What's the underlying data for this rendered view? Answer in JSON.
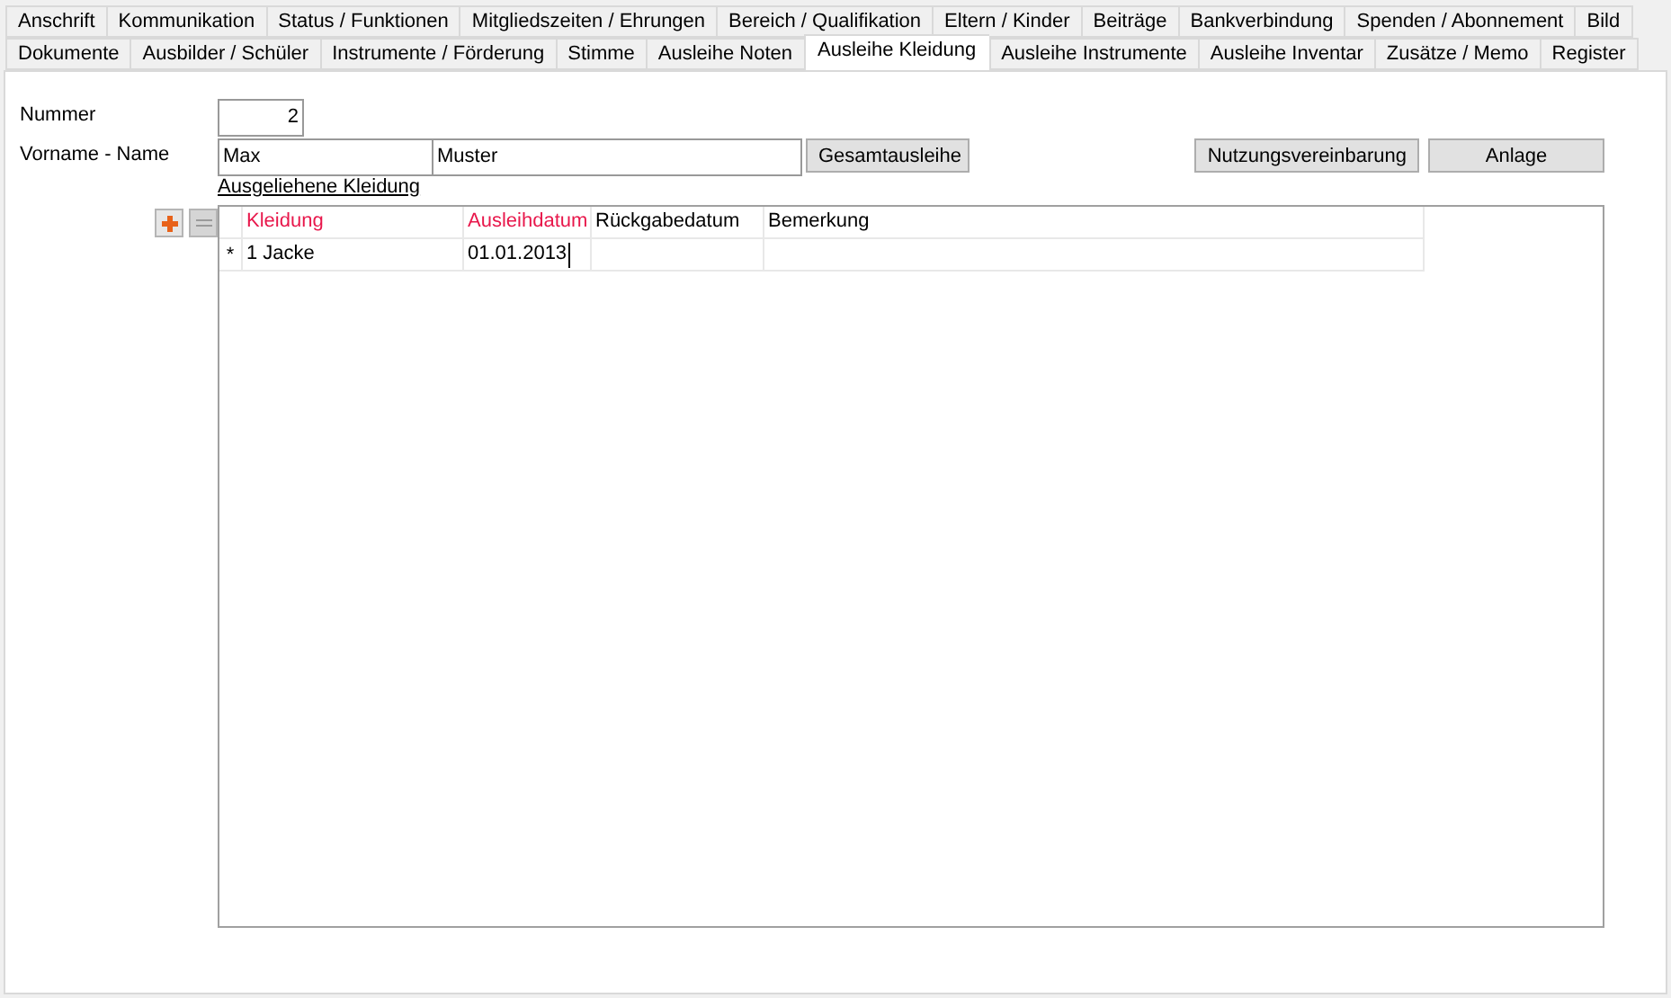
{
  "tab_rows": [
    [
      {
        "label": "Anschrift",
        "selected": false
      },
      {
        "label": "Kommunikation",
        "selected": false
      },
      {
        "label": "Status / Funktionen",
        "selected": false
      },
      {
        "label": "Mitgliedszeiten / Ehrungen",
        "selected": false
      },
      {
        "label": "Bereich / Qualifikation",
        "selected": false
      },
      {
        "label": "Eltern / Kinder",
        "selected": false
      },
      {
        "label": "Beiträge",
        "selected": false
      },
      {
        "label": "Bankverbindung",
        "selected": false
      },
      {
        "label": "Spenden / Abonnement",
        "selected": false
      },
      {
        "label": "Bild",
        "selected": false
      }
    ],
    [
      {
        "label": "Dokumente",
        "selected": false
      },
      {
        "label": "Ausbilder / Schüler",
        "selected": false
      },
      {
        "label": "Instrumente / Förderung",
        "selected": false
      },
      {
        "label": "Stimme",
        "selected": false
      },
      {
        "label": "Ausleihe Noten",
        "selected": false
      },
      {
        "label": "Ausleihe Kleidung",
        "selected": true
      },
      {
        "label": "Ausleihe Instrumente",
        "selected": false
      },
      {
        "label": "Ausleihe Inventar",
        "selected": false
      },
      {
        "label": "Zusätze / Memo",
        "selected": false
      },
      {
        "label": "Register",
        "selected": false
      }
    ]
  ],
  "form": {
    "number_label": "Nummer",
    "number": "2",
    "name_label": "Vorname - Name",
    "first_name": "Max",
    "last_name": "Muster",
    "total_button": "Gesamtausleihe",
    "agreement_button": "Nutzungsvereinbarung",
    "attachment_button": "Anlage"
  },
  "table": {
    "title": "Ausgeliehene Kleidung",
    "columns": [
      {
        "label": "Kleidung",
        "required": true
      },
      {
        "label": "Ausleihdatum",
        "required": true
      },
      {
        "label": "Rückgabedatum",
        "required": false
      },
      {
        "label": "Bemerkung",
        "required": false
      }
    ],
    "rows": [
      {
        "marker": "*",
        "cells": [
          "1 Jacke",
          "01.01.2013",
          "",
          ""
        ]
      }
    ]
  }
}
